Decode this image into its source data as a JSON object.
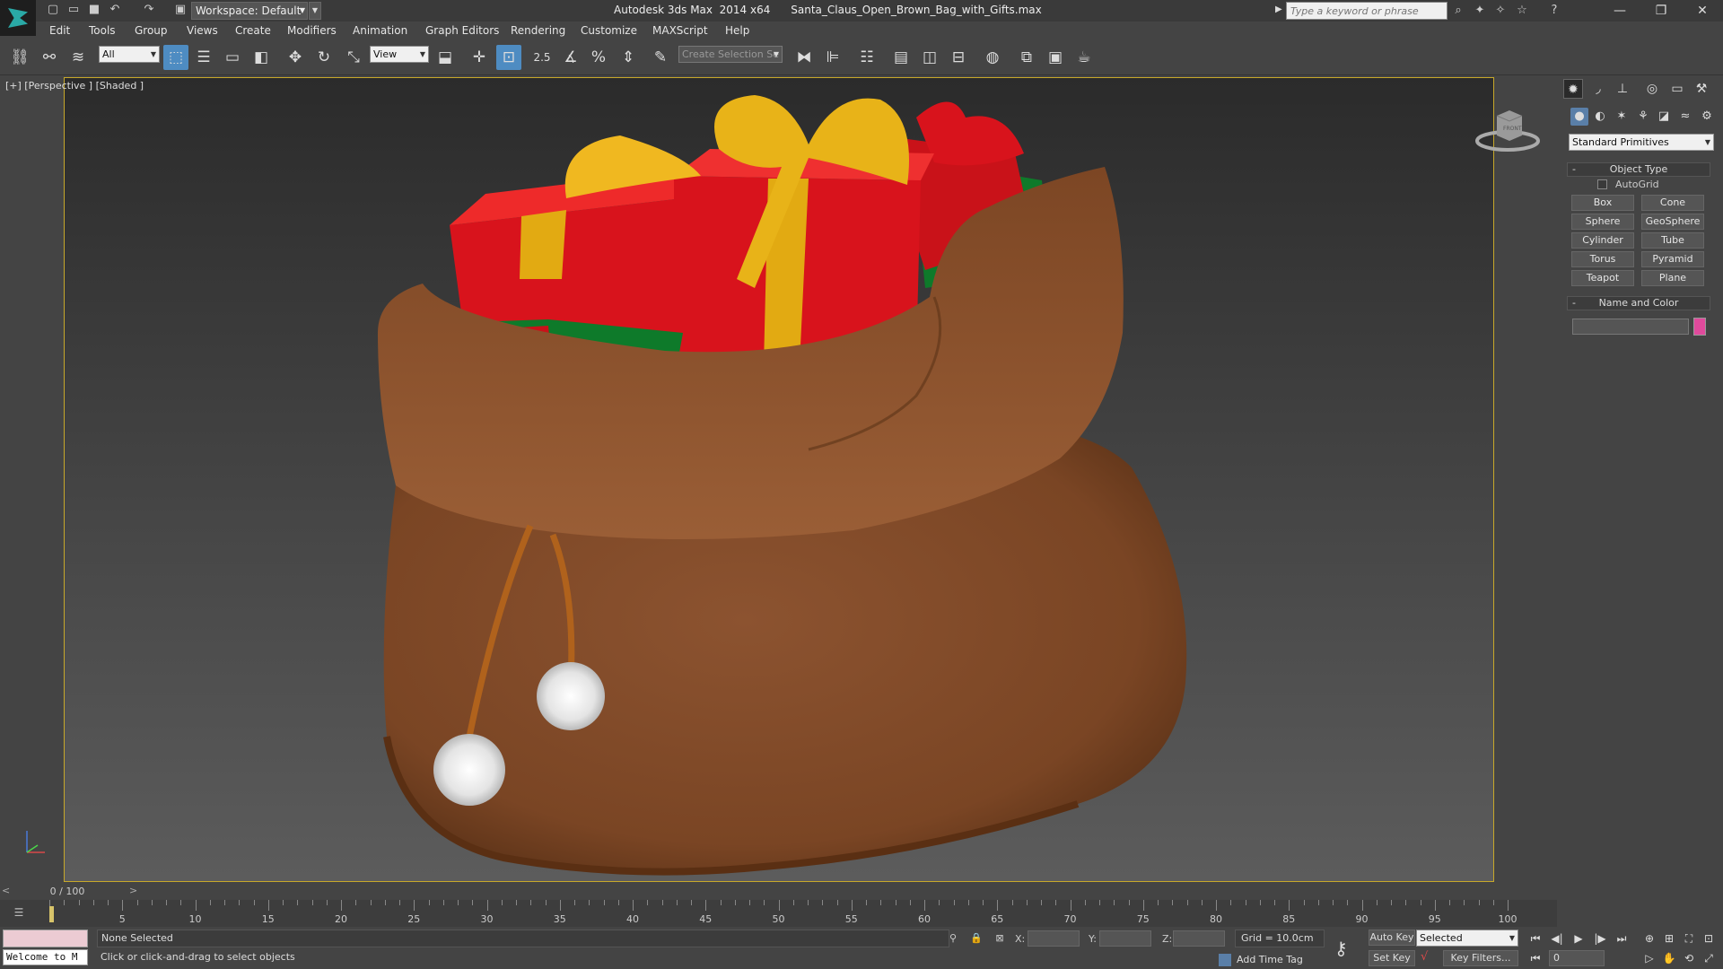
{
  "app": {
    "title": "Autodesk 3ds Max  2014 x64      Santa_Claus_Open_Brown_Bag_with_Gifts.max",
    "workspace": "Workspace: Default"
  },
  "search": {
    "placeholder": "Type a keyword or phrase"
  },
  "menu": [
    "Edit",
    "Tools",
    "Group",
    "Views",
    "Create",
    "Modifiers",
    "Animation",
    "Graph Editors",
    "Rendering",
    "Customize",
    "MAXScript",
    "Help"
  ],
  "toolbar": {
    "filter": "All",
    "ref_coord": "View",
    "snap_label": "2.5",
    "selection_set": "Create Selection Se"
  },
  "viewport": {
    "label": "[+] [Perspective ] [Shaded ]",
    "viewcube_label": "FRONT"
  },
  "command_panel": {
    "dropdown": "Standard Primitives",
    "object_type": {
      "title": "Object Type",
      "autogrid": "AutoGrid",
      "primitives": [
        "Box",
        "Cone",
        "Sphere",
        "GeoSphere",
        "Cylinder",
        "Tube",
        "Torus",
        "Pyramid",
        "Teapot",
        "Plane"
      ]
    },
    "name_color": {
      "title": "Name and Color",
      "color": "#e04a9c"
    }
  },
  "timeline": {
    "slider": "0 / 100",
    "ticks": [
      5,
      10,
      15,
      20,
      25,
      30,
      35,
      40,
      45,
      50,
      55,
      60,
      65,
      70,
      75,
      80,
      85,
      90,
      95,
      100
    ],
    "start": 0,
    "end": 100
  },
  "status": {
    "maxscript": "Welcome to M",
    "selection": "None Selected",
    "prompt": "Click or click-and-drag to select objects",
    "x_label": "X:",
    "y_label": "Y:",
    "z_label": "Z:",
    "grid": "Grid = 10.0cm",
    "add_time_tag": "Add Time Tag",
    "auto_key": "Auto Key",
    "set_key": "Set Key",
    "key_mode": "Selected",
    "key_filters": "Key Filters...",
    "frame": "0"
  },
  "colors": {
    "viewport_border": "#c7a82a",
    "active_tool": "#4e8cc2",
    "bag": "#8a4f2a",
    "gift_red": "#d8131c",
    "gift_green": "#0e7a2a",
    "ribbon_gold": "#e2aa12"
  }
}
